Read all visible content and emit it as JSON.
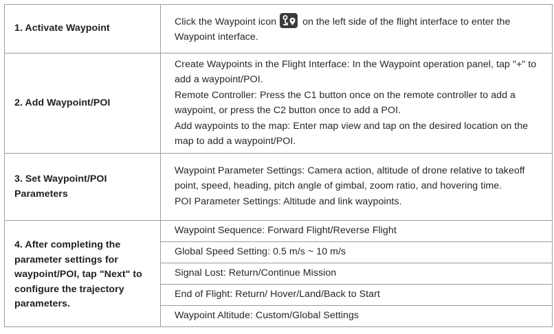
{
  "rows": [
    {
      "step": "1. Activate Waypoint",
      "desc_before_icon": "Click the Waypoint icon",
      "desc_after_icon": "on the left side of the flight interface to enter the Waypoint interface.",
      "icon": "waypoint-icon"
    },
    {
      "step": "2. Add Waypoint/POI",
      "paragraphs": [
        "Create Waypoints in the Flight Interface: In the Waypoint operation panel, tap \"+\" to add a waypoint/POI.",
        "Remote Controller: Press the C1 button once on the remote controller to add a waypoint, or press the C2 button once to add a POI.",
        "Add waypoints to the map: Enter map view and tap on the desired location on the map to add a waypoint/POI."
      ]
    },
    {
      "step": "3. Set Waypoint/POI Parameters",
      "paragraphs": [
        "Waypoint Parameter Settings: Camera action, altitude of drone relative to takeoff point, speed, heading, pitch angle of gimbal, zoom ratio, and hovering time.",
        "POI Parameter Settings: Altitude and link waypoints."
      ]
    },
    {
      "step": "4. After completing the parameter settings for waypoint/POI, tap \"Next\" to configure the trajectory parameters.",
      "items": [
        "Waypoint Sequence: Forward Flight/Reverse Flight",
        "Global Speed Setting: 0.5 m/s ~ 10 m/s",
        "Signal Lost: Return/Continue Mission",
        "End of Flight: Return/ Hover/Land/Back to Start",
        "Waypoint Altitude: Custom/Global Settings"
      ]
    }
  ]
}
